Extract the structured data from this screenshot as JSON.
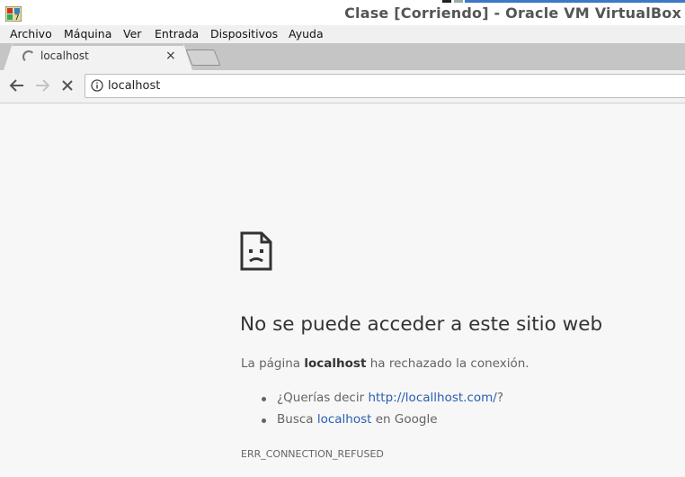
{
  "window": {
    "title": "Clase [Corriendo] - Oracle VM VirtualBox",
    "app_icon": "virtualbox-icon"
  },
  "menu": [
    "Archivo",
    "Máquina",
    "Ver",
    "Entrada",
    "Dispositivos",
    "Ayuda"
  ],
  "tab": {
    "title": "localhost",
    "state": "loading-spinner",
    "close": "×"
  },
  "address_bar": {
    "url": "localhost",
    "icons": [
      "back-icon",
      "forward-icon",
      "stop-icon",
      "info-icon"
    ]
  },
  "error_page": {
    "icon": "sad-page-icon",
    "heading": "No se puede acceder a este sitio web",
    "desc_prefix": "La página ",
    "desc_host": "localhost",
    "desc_suffix": " ha rechazado la conexión.",
    "suggestion1_prefix": "¿Querías decir ",
    "suggestion1_link": "http://locallhost.com/",
    "suggestion1_suffix": "?",
    "suggestion2_prefix": "Busca ",
    "suggestion2_link": "localhost",
    "suggestion2_suffix": " en Google",
    "error_code": "ERR_CONNECTION_REFUSED"
  },
  "colors": {
    "link": "#2a5db0",
    "text": "#646464",
    "heading": "#333333",
    "page_bg": "#f7f7f7"
  }
}
